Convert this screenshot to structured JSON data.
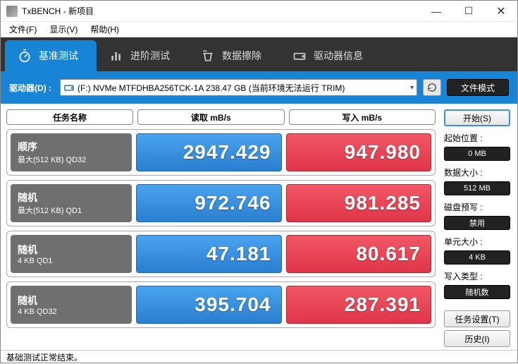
{
  "window": {
    "title": "TxBENCH - 新项目"
  },
  "menu": {
    "file": "文件(F)",
    "view": "显示(V)",
    "help": "帮助(H)"
  },
  "tabs": {
    "basic": "基准测试",
    "advanced": "进阶测试",
    "erase": "数据擦除",
    "driveinfo": "驱动器信息"
  },
  "toolbar": {
    "drive_label": "驱动器(D) :",
    "drive_value": "(F:) NVMe MTFDHBA256TCK-1A   238.47 GB (当前环境无法运行 TRIM)",
    "file_mode": "文件模式"
  },
  "headers": {
    "task": "任务名称",
    "read": "读取 mB/s",
    "write": "写入 mB/s"
  },
  "rows": [
    {
      "title": "顺序",
      "sub": "最大(512 KB) QD32",
      "read": "2947.429",
      "write": "947.980"
    },
    {
      "title": "随机",
      "sub": "最大(512 KB) QD1",
      "read": "972.746",
      "write": "981.285"
    },
    {
      "title": "随机",
      "sub": "4 KB QD1",
      "read": "47.181",
      "write": "80.617"
    },
    {
      "title": "随机",
      "sub": "4 KB QD32",
      "read": "395.704",
      "write": "287.391"
    }
  ],
  "sidebar": {
    "start": "开始(S)",
    "start_pos": "起始位置 :",
    "start_pos_val": "0 MB",
    "data_size": "数据大小 :",
    "data_size_val": "512 MB",
    "disk_prefill": "磁盘预写 :",
    "disk_prefill_val": "禁用",
    "unit_size": "单元大小 :",
    "unit_size_val": "4 KB",
    "write_type": "写入类型 :",
    "write_type_val": "随机数",
    "task_settings": "任务设置(T)",
    "history": "历史(I)"
  },
  "status": "基础测试正常结束。"
}
